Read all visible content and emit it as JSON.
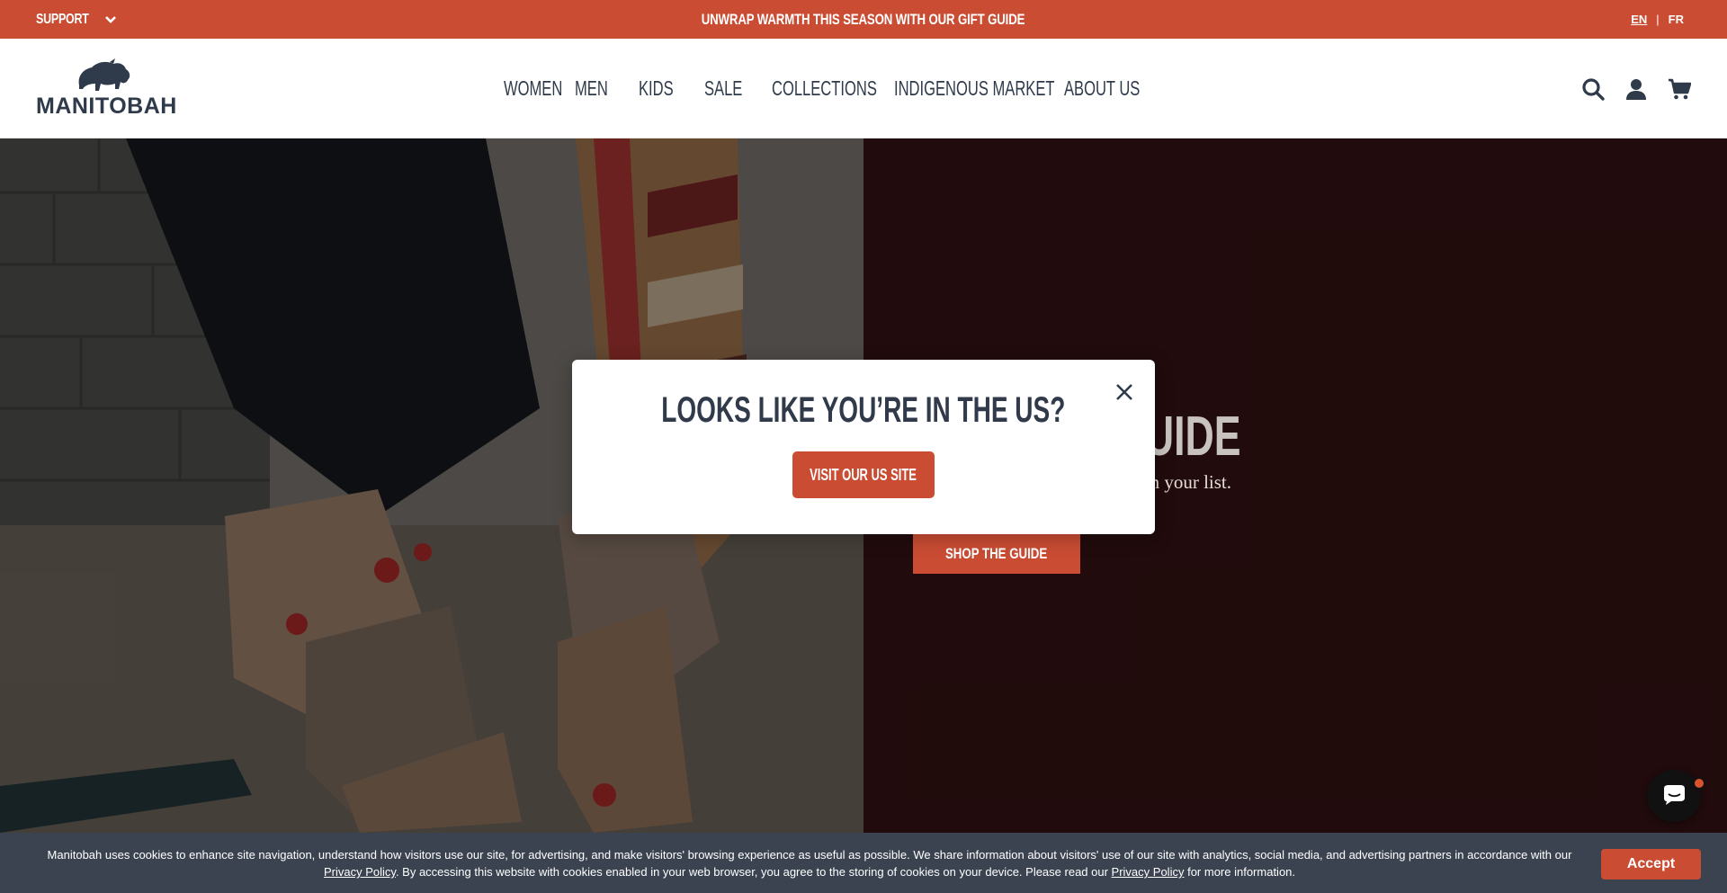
{
  "announcement": {
    "support_label": "SUPPORT",
    "message": "UNWRAP WARMTH THIS SEASON WITH OUR GIFT GUIDE",
    "lang_en": "EN",
    "lang_separator": "|",
    "lang_fr": "FR"
  },
  "header": {
    "logo_text": "MANITOBAH",
    "nav": [
      "WOMEN",
      "MEN",
      "KIDS",
      "SALE",
      "COLLECTIONS",
      "INDIGENOUS MARKET",
      "ABOUT US"
    ]
  },
  "hero": {
    "title": "MTH GIFT GUIDE",
    "subtitle": "lasting memories to everyone on your list.",
    "cta": "SHOP THE GUIDE"
  },
  "modal": {
    "title": "LOOKS LIKE YOU’RE IN THE US?",
    "button": "VISIT OUR US SITE"
  },
  "cookie": {
    "text_1": "Manitobah uses cookies to enhance site navigation, understand how visitors use our site, for advertising, and make visitors' browsing experience as useful as possible. We share information about visitors' use of our site with analytics, social media, and advertising partners in accordance with our ",
    "link_1": "Privacy Policy",
    "text_2": ". By accessing this website with cookies enabled in your web browser, you agree to the storing of cookies on your device. Please read our ",
    "link_2": "Privacy Policy",
    "text_3": " for more information.",
    "accept": "Accept"
  },
  "colors": {
    "brand_red": "#c94c33",
    "navy": "#2f3a4a",
    "hero_right_bg": "#3d1516",
    "cookie_bg": "#3b4351"
  }
}
